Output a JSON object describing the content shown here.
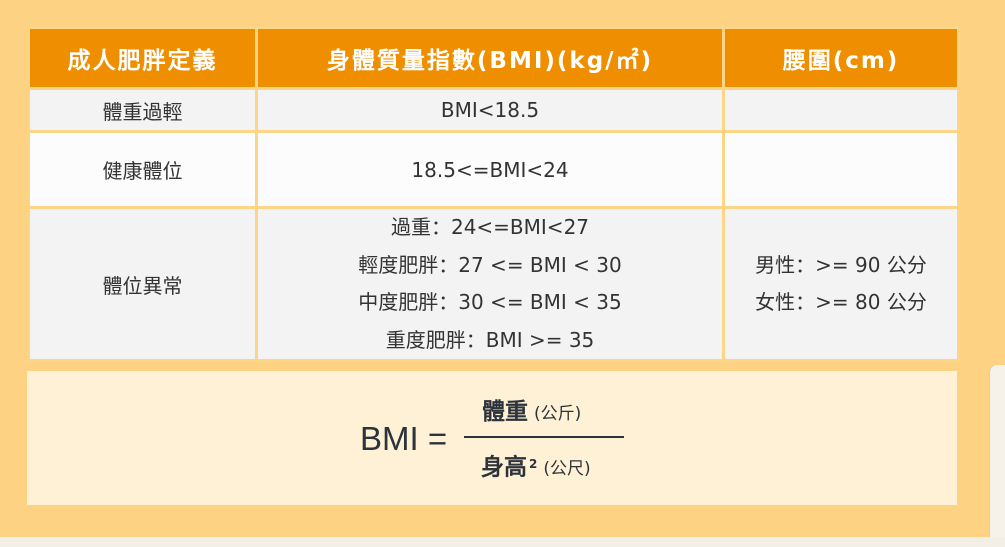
{
  "table": {
    "headers": [
      "成人肥胖定義",
      "身體質量指數(BMI)(kg/㎡)",
      "腰圍(cm)"
    ],
    "rows": {
      "underweight": {
        "label": "體重過輕",
        "bmi": "BMI<18.5",
        "waist": ""
      },
      "normal": {
        "label": "健康體位",
        "bmi": "18.5<=BMI<24",
        "waist": ""
      },
      "abnormal": {
        "label": "體位異常",
        "bmi_lines": [
          "過重：24<=BMI<27",
          "輕度肥胖：27 <= BMI < 30",
          "中度肥胖：30 <= BMI < 35",
          "重度肥胖：BMI >= 35"
        ],
        "waist_lines": [
          "男性：>= 90 公分",
          "女性：>= 80 公分"
        ]
      }
    }
  },
  "formula": {
    "lhs": "BMI =",
    "numerator": "體重",
    "numerator_unit": "(公斤)",
    "denominator": "身高",
    "exponent": "2",
    "denominator_unit": "(公尺)"
  },
  "colors": {
    "page_background": "#fdd282",
    "header_background": "#ef8f00",
    "header_text": "#ffffff",
    "row_alt": "#f3f3f3",
    "row_plain": "#fcfcfc",
    "formula_background": "#fff1d6"
  }
}
